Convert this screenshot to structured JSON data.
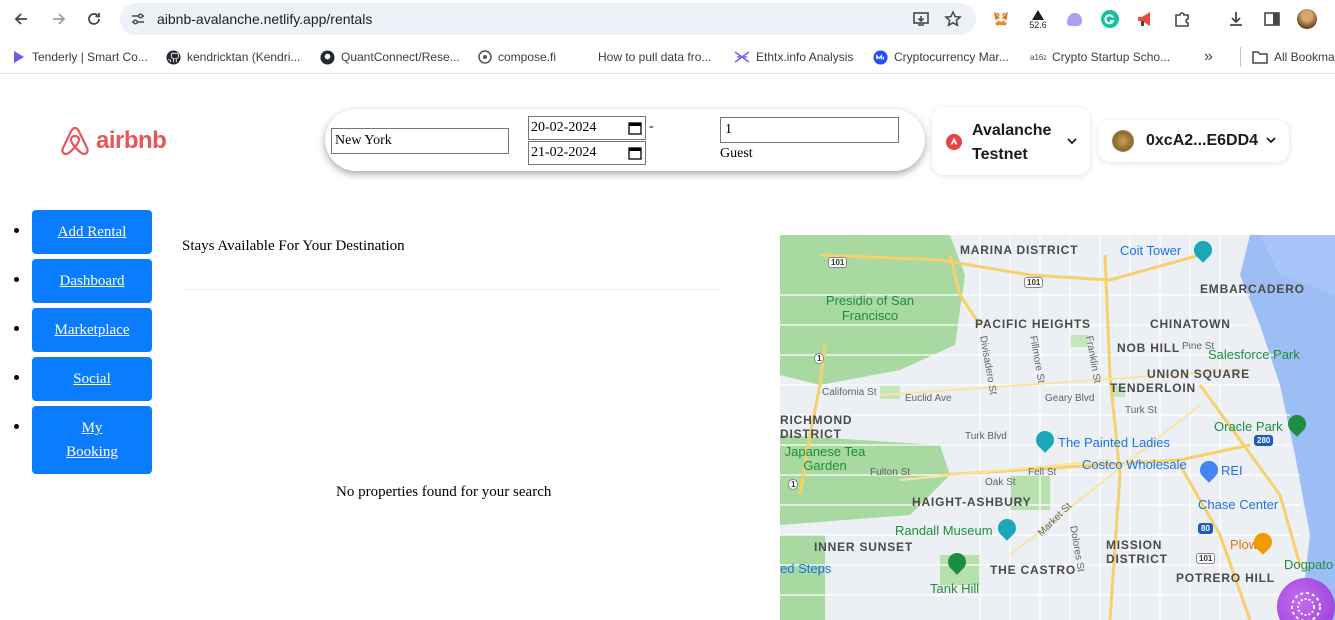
{
  "browser": {
    "url": "aibnb-avalanche.netlify.app/rentals",
    "extension_badge": "52.6",
    "bookmarks": [
      {
        "label": "Tenderly | Smart Co...",
        "color": "#6c5ce7"
      },
      {
        "label": "kendricktan (Kendri...",
        "color": "#24292f"
      },
      {
        "label": "QuantConnect/Rese...",
        "color": "#24292f"
      },
      {
        "label": "compose.fi",
        "color": "#555555"
      },
      {
        "label": "How to pull data fro...",
        "color": "#ffffff"
      },
      {
        "label": "Ethtx.info Analysis",
        "color": "#7b61ff"
      },
      {
        "label": "Cryptocurrency Mar...",
        "color": "#1e4fff"
      },
      {
        "label": "Crypto Startup Scho...",
        "color": "#444444"
      }
    ],
    "all_bookmarks": "All Bookmarks"
  },
  "header": {
    "logo_text": "airbnb",
    "search": {
      "location": "New York",
      "checkin": "20-02-2024",
      "checkout": "21-02-2024",
      "separator": "-",
      "guests": "1",
      "guest_label": "Guest"
    },
    "network": {
      "name": "Avalanche Testnet"
    },
    "account": {
      "address": "0xcA2...E6DD4"
    }
  },
  "sidebar": {
    "items": [
      {
        "label": "Add Rental"
      },
      {
        "label": "Dashboard"
      },
      {
        "label": "Marketplace"
      },
      {
        "label": "Social"
      },
      {
        "label": "My Booking"
      }
    ]
  },
  "main": {
    "title": "Stays Available For Your Destination",
    "empty_message": "No properties found for your search"
  },
  "map": {
    "labels": {
      "marina": "MARINA DISTRICT",
      "coit": "Coit Tower",
      "embarcadero": "EMBARCADERO",
      "presidio": "Presidio of San Francisco",
      "pacific_heights": "PACIFIC HEIGHTS",
      "chinatown": "CHINATOWN",
      "nob_hill": "NOB HILL",
      "pine": "Pine St",
      "salesforce": "Salesforce Park",
      "union_square": "UNION SQUARE",
      "tenderloin": "TENDERLOIN",
      "california": "California St",
      "euclid": "Euclid Ave",
      "geary": "Geary Blvd",
      "richmond": "RICHMOND DISTRICT",
      "turk": "Turk St",
      "oracle": "Oracle Park",
      "japanese": "Japanese Tea Garden",
      "painted": "The Painted Ladies",
      "costco": "Costco Wholesale",
      "rei": "REI",
      "fulton": "Fulton St",
      "oak": "Oak St",
      "fell": "Fell St",
      "haight": "HAIGHT-ASHBURY",
      "chase": "Chase Center",
      "randall": "Randall Museum",
      "inner_sunset": "INNER SUNSET",
      "mission": "MISSION DISTRICT",
      "plow": "Plow",
      "castro": "THE CASTRO",
      "steps": "ed Steps",
      "tank": "Tank Hill",
      "potrero": "POTRERO HILL",
      "dogpatch": "Dogpato",
      "divisadero": "Divisadero St",
      "fillmore": "Fillmore St",
      "franklin": "Franklin St",
      "turk_blvd": "Turk Blvd",
      "market": "Market St",
      "dolores": "Dolores St"
    }
  }
}
